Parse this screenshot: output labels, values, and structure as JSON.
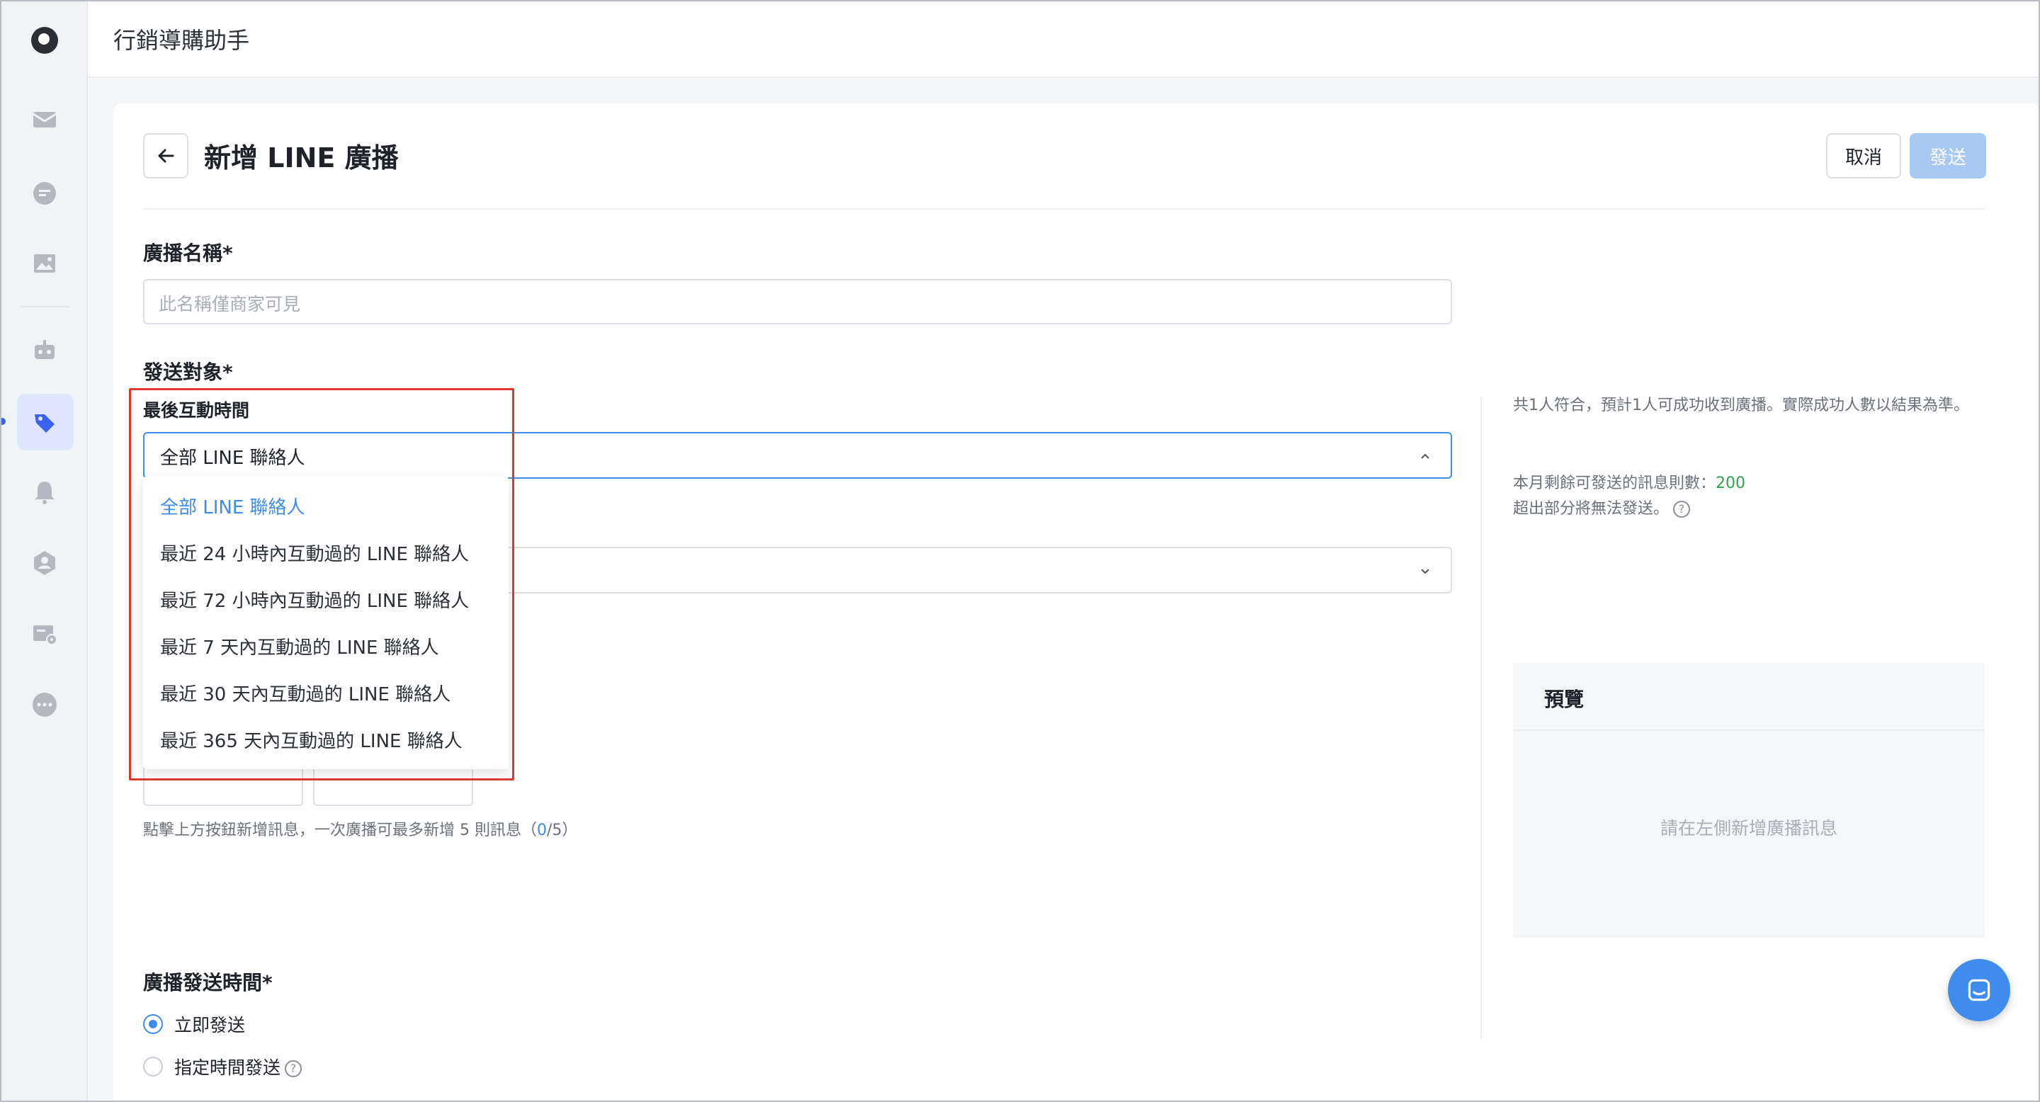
{
  "app": {
    "title": "行銷導購助手"
  },
  "sidebar": {
    "items": [
      {
        "icon": "mail-icon"
      },
      {
        "icon": "chat-icon"
      },
      {
        "icon": "image-icon"
      },
      {
        "icon": "robot-icon"
      },
      {
        "icon": "tag-icon",
        "active": true
      },
      {
        "icon": "bell-icon"
      },
      {
        "icon": "user-hex-icon"
      },
      {
        "icon": "card-settings-icon"
      },
      {
        "icon": "more-icon"
      }
    ]
  },
  "header": {
    "title": "新增 LINE 廣播",
    "cancel_label": "取消",
    "send_label": "發送"
  },
  "form": {
    "name_label": "廣播名稱*",
    "name_placeholder": "此名稱僅商家可見",
    "target_label": "發送對象*",
    "last_interaction_label": "最後互動時間",
    "last_interaction_value": "全部 LINE 聯絡人",
    "dropdown_options": [
      "全部 LINE 聯絡人",
      "最近 24 小時內互動過的 LINE 聯絡人",
      "最近 72 小時內互動過的 LINE 聯絡人",
      "最近 7 天內互動過的 LINE 聯絡人",
      "最近 30 天內互動過的 LINE 聯絡人",
      "最近 365 天內互動過的 LINE 聯絡人"
    ],
    "selected_option_index": 0,
    "message_hint_prefix": "點擊上方按鈕新增訊息，一次廣播可最多新增 5 則訊息（",
    "message_count": "0",
    "message_hint_suffix": "/5）",
    "schedule_label": "廣播發送時間*",
    "schedule_options": [
      {
        "label": "立即發送",
        "checked": true
      },
      {
        "label": "指定時間發送",
        "checked": false
      }
    ]
  },
  "side_info": {
    "match_text": "共1人符合，預計1人可成功收到廣播。實際成功人數以結果為準。",
    "remaining_label": "本月剩餘可發送的訊息則數：",
    "remaining_value": "200",
    "overflow_text": "超出部分將無法發送。"
  },
  "preview": {
    "title": "預覽",
    "empty_text": "請在左側新增廣播訊息"
  },
  "colors": {
    "accent": "#3f8cec",
    "highlight_box": "#e0382f",
    "remaining_value": "#2ea44f"
  }
}
